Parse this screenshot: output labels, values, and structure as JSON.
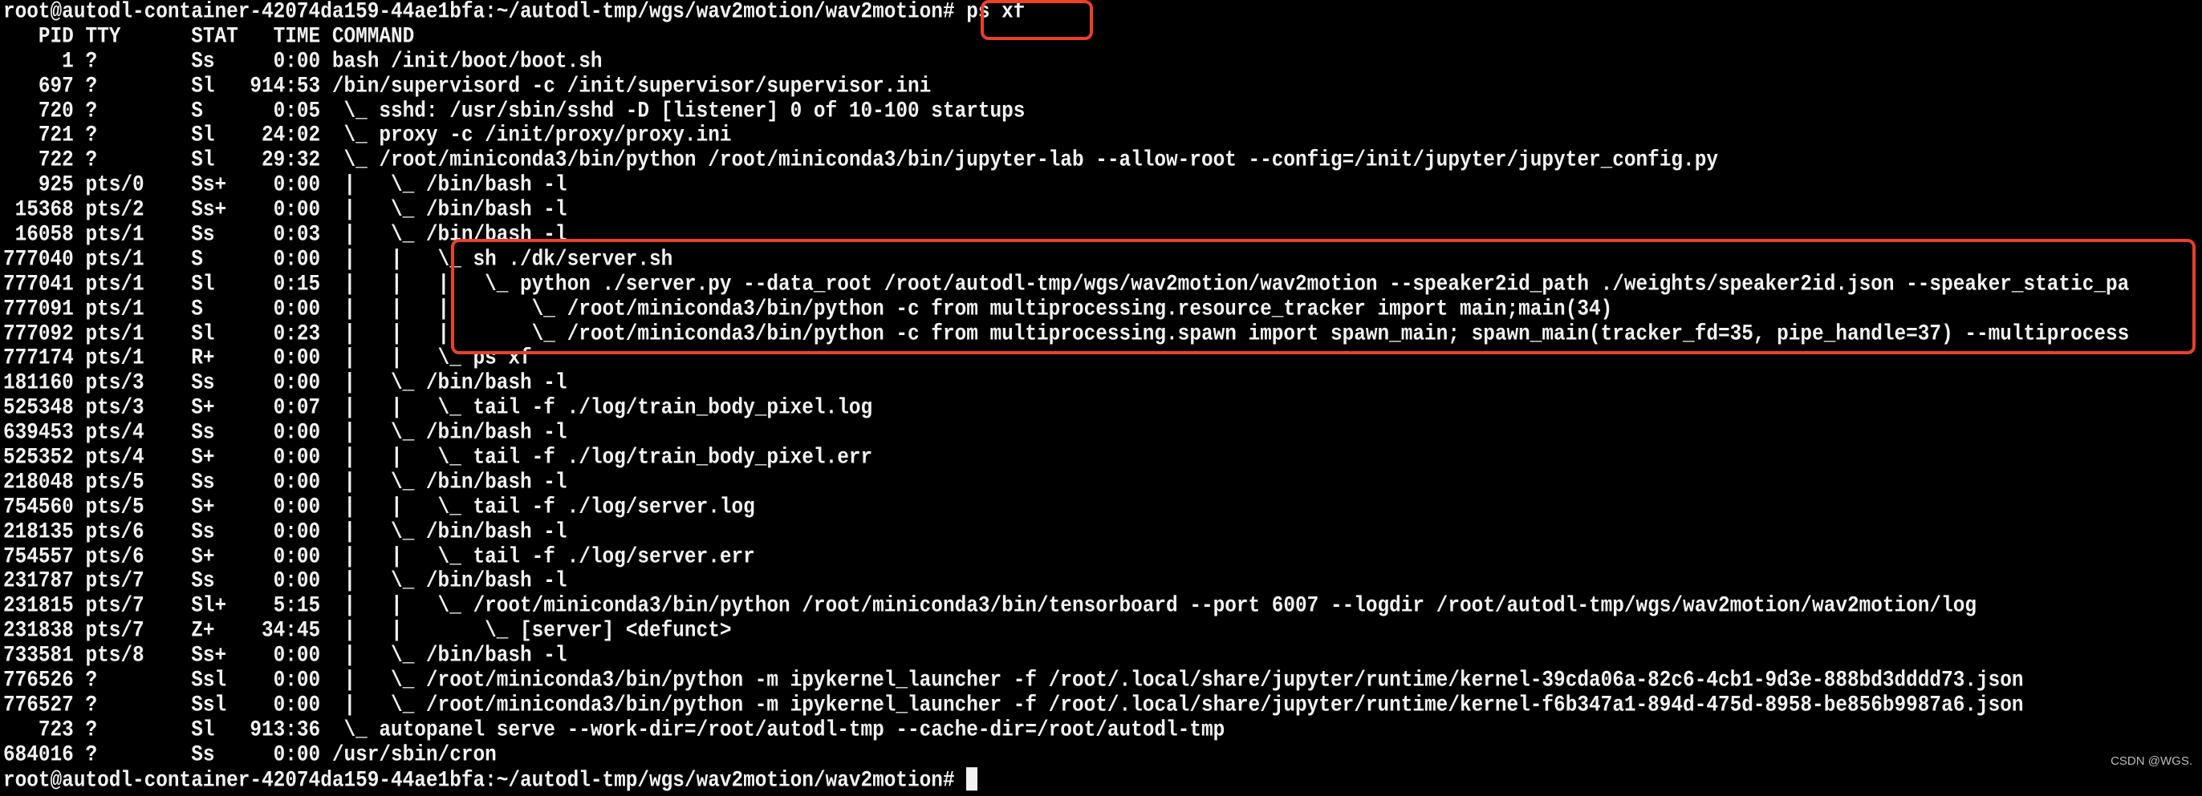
{
  "terminal": {
    "prompt": "root@autodl-container-42074da159-44ae1bfa:~/autodl-tmp/wgs/wav2motion/wav2motion#",
    "command": "ps xf",
    "lines": [
      "   PID TTY      STAT   TIME COMMAND",
      "     1 ?        Ss     0:00 bash /init/boot/boot.sh",
      "   697 ?        Sl   914:53 /bin/supervisord -c /init/supervisor/supervisor.ini",
      "   720 ?        S      0:05  \\_ sshd: /usr/sbin/sshd -D [listener] 0 of 10-100 startups",
      "   721 ?        Sl    24:02  \\_ proxy -c /init/proxy/proxy.ini",
      "   722 ?        Sl    29:32  \\_ /root/miniconda3/bin/python /root/miniconda3/bin/jupyter-lab --allow-root --config=/init/jupyter/jupyter_config.py",
      "   925 pts/0    Ss+    0:00  |   \\_ /bin/bash -l",
      " 15368 pts/2    Ss+    0:00  |   \\_ /bin/bash -l",
      " 16058 pts/1    Ss     0:03  |   \\_ /bin/bash -l",
      "777040 pts/1    S      0:00  |   |   \\_ sh ./dk/server.sh",
      "777041 pts/1    Sl     0:15  |   |   |   \\_ python ./server.py --data_root /root/autodl-tmp/wgs/wav2motion/wav2motion --speaker2id_path ./weights/speaker2id.json --speaker_static_pa",
      "777091 pts/1    S      0:00  |   |   |       \\_ /root/miniconda3/bin/python -c from multiprocessing.resource_tracker import main;main(34)",
      "777092 pts/1    Sl     0:23  |   |   |       \\_ /root/miniconda3/bin/python -c from multiprocessing.spawn import spawn_main; spawn_main(tracker_fd=35, pipe_handle=37) --multiprocess",
      "777174 pts/1    R+     0:00  |   |   \\_ ps xf",
      "181160 pts/3    Ss     0:00  |   \\_ /bin/bash -l",
      "525348 pts/3    S+     0:07  |   |   \\_ tail -f ./log/train_body_pixel.log",
      "639453 pts/4    Ss     0:00  |   \\_ /bin/bash -l",
      "525352 pts/4    S+     0:00  |   |   \\_ tail -f ./log/train_body_pixel.err",
      "218048 pts/5    Ss     0:00  |   \\_ /bin/bash -l",
      "754560 pts/5    S+     0:00  |   |   \\_ tail -f ./log/server.log",
      "218135 pts/6    Ss     0:00  |   \\_ /bin/bash -l",
      "754557 pts/6    S+     0:00  |   |   \\_ tail -f ./log/server.err",
      "231787 pts/7    Ss     0:00  |   \\_ /bin/bash -l",
      "231815 pts/7    Sl+    5:15  |   |   \\_ /root/miniconda3/bin/python /root/miniconda3/bin/tensorboard --port 6007 --logdir /root/autodl-tmp/wgs/wav2motion/wav2motion/log",
      "231838 pts/7    Z+    34:45  |   |       \\_ [server] <defunct>",
      "733581 pts/8    Ss+    0:00  |   \\_ /bin/bash -l",
      "776526 ?        Ssl    0:00  |   \\_ /root/miniconda3/bin/python -m ipykernel_launcher -f /root/.local/share/jupyter/runtime/kernel-39cda06a-82c6-4cb1-9d3e-888bd3dddd73.json",
      "776527 ?        Ssl    0:00  |   \\_ /root/miniconda3/bin/python -m ipykernel_launcher -f /root/.local/share/jupyter/runtime/kernel-f6b347a1-894d-475d-8958-be856b9987a6.json",
      "   723 ?        Sl   913:36  \\_ autopanel serve --work-dir=/root/autodl-tmp --cache-dir=/root/autodl-tmp",
      "684016 ?        Ss     0:00 /usr/sbin/cron"
    ]
  },
  "colors": {
    "background": "#000000",
    "text": "#f2f2f2",
    "highlight": "#e8412c"
  },
  "watermark": "CSDN @WGS."
}
